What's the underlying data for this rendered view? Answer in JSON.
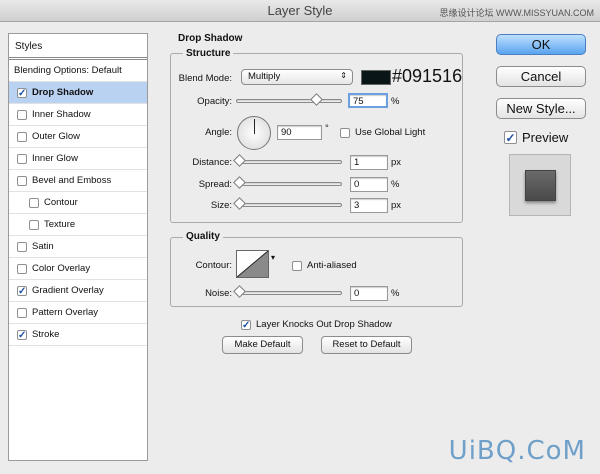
{
  "window": {
    "title": "Layer Style",
    "watermark_top": "思缘设计论坛 WWW.MISSYUAN.COM",
    "watermark_bottom": "UiBQ.CoM"
  },
  "sidebar": {
    "header": "Styles",
    "items": [
      {
        "label": "Blending Options: Default",
        "checkbox": false,
        "checked": false,
        "selected": false,
        "sub": false
      },
      {
        "label": "Drop Shadow",
        "checkbox": true,
        "checked": true,
        "selected": true,
        "sub": false
      },
      {
        "label": "Inner Shadow",
        "checkbox": true,
        "checked": false,
        "selected": false,
        "sub": false
      },
      {
        "label": "Outer Glow",
        "checkbox": true,
        "checked": false,
        "selected": false,
        "sub": false
      },
      {
        "label": "Inner Glow",
        "checkbox": true,
        "checked": false,
        "selected": false,
        "sub": false
      },
      {
        "label": "Bevel and Emboss",
        "checkbox": true,
        "checked": false,
        "selected": false,
        "sub": false
      },
      {
        "label": "Contour",
        "checkbox": true,
        "checked": false,
        "selected": false,
        "sub": true
      },
      {
        "label": "Texture",
        "checkbox": true,
        "checked": false,
        "selected": false,
        "sub": true
      },
      {
        "label": "Satin",
        "checkbox": true,
        "checked": false,
        "selected": false,
        "sub": false
      },
      {
        "label": "Color Overlay",
        "checkbox": true,
        "checked": false,
        "selected": false,
        "sub": false
      },
      {
        "label": "Gradient Overlay",
        "checkbox": true,
        "checked": true,
        "selected": false,
        "sub": false
      },
      {
        "label": "Pattern Overlay",
        "checkbox": true,
        "checked": false,
        "selected": false,
        "sub": false
      },
      {
        "label": "Stroke",
        "checkbox": true,
        "checked": true,
        "selected": false,
        "sub": false
      }
    ]
  },
  "drop_shadow": {
    "title": "Drop Shadow",
    "structure": {
      "title": "Structure",
      "blend_mode_label": "Blend Mode:",
      "blend_mode_value": "Multiply",
      "color_hex": "#091516",
      "opacity_label": "Opacity:",
      "opacity_value": "75",
      "opacity_unit": "%",
      "angle_label": "Angle:",
      "angle_value": "90",
      "angle_unit": "°",
      "use_global_light_label": "Use Global Light",
      "use_global_light_checked": false,
      "distance_label": "Distance:",
      "distance_value": "1",
      "distance_unit": "px",
      "spread_label": "Spread:",
      "spread_value": "0",
      "spread_unit": "%",
      "size_label": "Size:",
      "size_value": "3",
      "size_unit": "px"
    },
    "quality": {
      "title": "Quality",
      "contour_label": "Contour:",
      "anti_aliased_label": "Anti-aliased",
      "anti_aliased_checked": false,
      "noise_label": "Noise:",
      "noise_value": "0",
      "noise_unit": "%"
    },
    "knocks_out_label": "Layer Knocks Out Drop Shadow",
    "knocks_out_checked": true,
    "make_default_label": "Make Default",
    "reset_default_label": "Reset to Default"
  },
  "actions": {
    "ok_label": "OK",
    "cancel_label": "Cancel",
    "new_style_label": "New Style...",
    "preview_label": "Preview",
    "preview_checked": true
  }
}
